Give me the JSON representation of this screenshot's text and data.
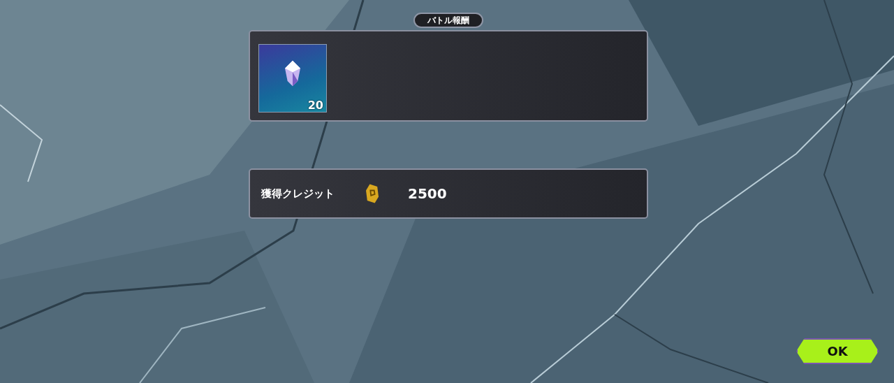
{
  "title": "バトル報酬",
  "rewards": [
    {
      "kind": "crystal",
      "count": "20"
    }
  ],
  "credit": {
    "label": "獲得クレジット",
    "amount": "2500"
  },
  "buttons": [
    {
      "label": "OK"
    }
  ]
}
